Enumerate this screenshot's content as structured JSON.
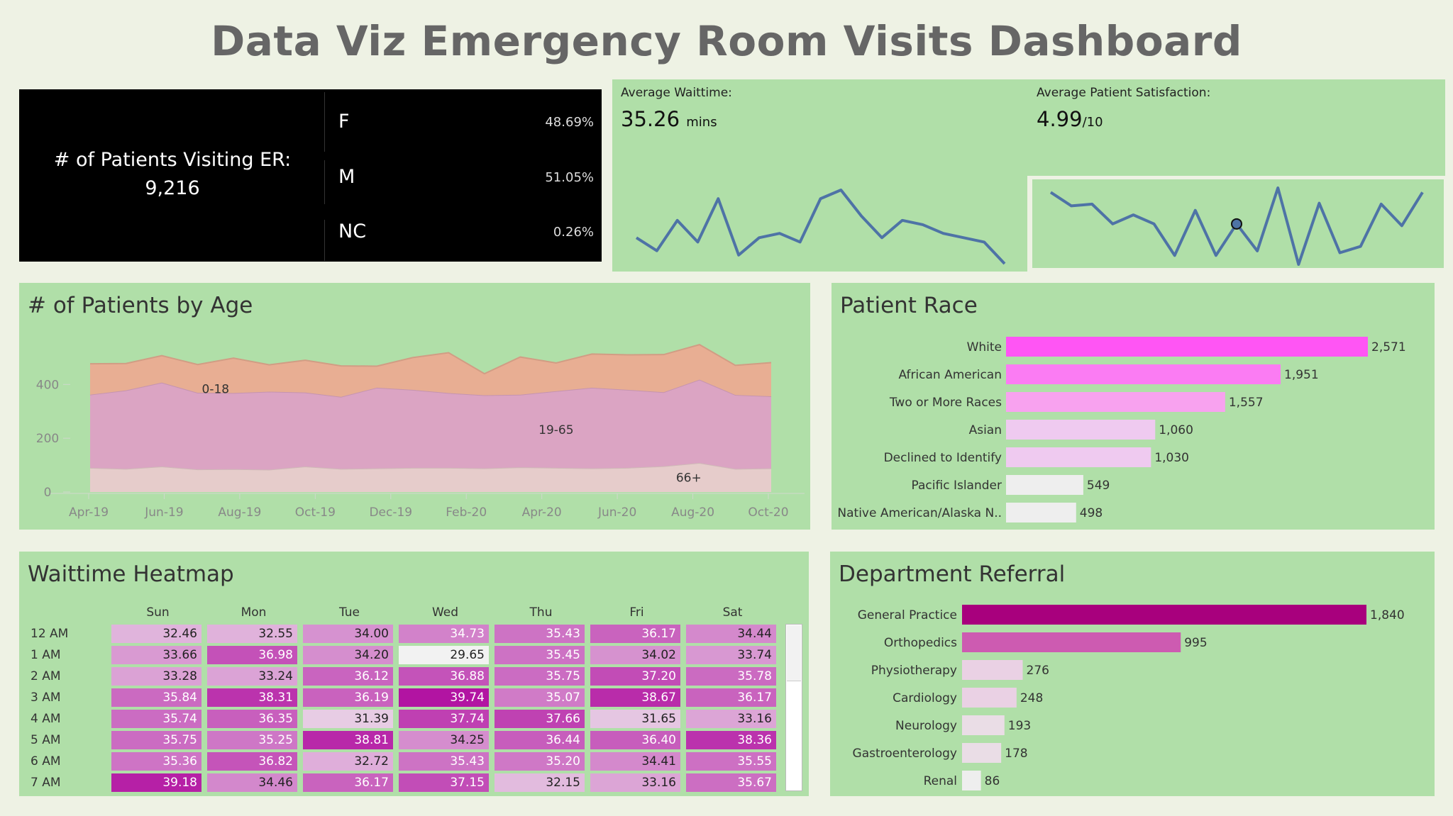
{
  "title": "Data Viz Emergency Room Visits Dashboard",
  "patients": {
    "label": "# of Patients Visiting ER:",
    "count": "9,216",
    "genders": [
      {
        "label": "F",
        "pct": "48.69%"
      },
      {
        "label": "M",
        "pct": "51.05%"
      },
      {
        "label": "NC",
        "pct": "0.26%"
      }
    ]
  },
  "waittime": {
    "label": "Average Waittime:",
    "value": "35.26",
    "unit": "mins"
  },
  "satisfaction": {
    "label": "Average Patient Satisfaction:",
    "value": "4.99",
    "unit": "/10"
  },
  "colors": {
    "panel": "#b0dfa8",
    "background": "#eef2e4",
    "line": "#4e73a6",
    "bar_top": "#ff55f4",
    "dept_top": "#a8007d"
  },
  "chart_data": [
    {
      "id": "waittime_trend",
      "type": "line",
      "values": [
        34.9,
        34.6,
        35.3,
        34.8,
        35.8,
        34.5,
        34.9,
        35.0,
        34.8,
        35.8,
        36.0,
        35.4,
        34.9,
        35.3,
        35.2,
        35.0,
        34.9,
        34.8,
        34.3
      ]
    },
    {
      "id": "satisfaction_trend",
      "type": "line",
      "values": [
        5.4,
        5.25,
        5.27,
        5.05,
        5.15,
        5.05,
        4.7,
        5.2,
        4.7,
        5.05,
        4.75,
        5.45,
        4.6,
        5.28,
        4.73,
        4.8,
        5.27,
        5.03,
        5.4
      ],
      "highlight_index": 9
    },
    {
      "id": "patients_by_age",
      "type": "area",
      "title": "# of Patients by Age",
      "x_ticks": [
        "Apr-19",
        "Jun-19",
        "Aug-19",
        "Oct-19",
        "Dec-19",
        "Feb-20",
        "Apr-20",
        "Jun-20",
        "Aug-20",
        "Oct-20"
      ],
      "y_ticks": [
        "0",
        "200",
        "400"
      ],
      "ylim": [
        0,
        580
      ],
      "series": [
        {
          "name": "66+",
          "color": "#e6cccb",
          "values": [
            90,
            86,
            95,
            84,
            85,
            83,
            95,
            86,
            88,
            90,
            90,
            88,
            92,
            90,
            88,
            90,
            96,
            108,
            86,
            88
          ]
        },
        {
          "name": "19-65",
          "color": "#dba4c3",
          "values": [
            272,
            292,
            312,
            285,
            283,
            290,
            275,
            268,
            300,
            290,
            278,
            272,
            270,
            285,
            300,
            290,
            275,
            310,
            275,
            268
          ]
        },
        {
          "name": "0-18",
          "color": "#e8ae93",
          "values": [
            115,
            100,
            100,
            105,
            130,
            100,
            120,
            115,
            80,
            120,
            150,
            80,
            140,
            105,
            125,
            130,
            140,
            130,
            110,
            125
          ]
        }
      ]
    },
    {
      "id": "patient_race",
      "type": "bar",
      "title": "Patient Race",
      "categories": [
        "White",
        "African American",
        "Two or More Races",
        "Asian",
        "Declined to Identify",
        "Pacific Islander",
        "Native American/Alaska N.."
      ],
      "values": [
        2571,
        1951,
        1557,
        1060,
        1030,
        549,
        498
      ],
      "labels": [
        "2,571",
        "1,951",
        "1,557",
        "1,060",
        "1,030",
        "549",
        "498"
      ],
      "colors": [
        "#ff55f4",
        "#fb7cf3",
        "#f8a2ef",
        "#efcaf0",
        "#efcaf0",
        "#eeeeee",
        "#eeeeee"
      ]
    },
    {
      "id": "department_referral",
      "type": "bar",
      "title": "Department Referral",
      "categories": [
        "General Practice",
        "Orthopedics",
        "Physiotherapy",
        "Cardiology",
        "Neurology",
        "Gastroenterology",
        "Renal"
      ],
      "values": [
        1840,
        995,
        276,
        248,
        193,
        178,
        86
      ],
      "labels": [
        "1,840",
        "995",
        "276",
        "248",
        "193",
        "178",
        "86"
      ],
      "colors": [
        "#a8007d",
        "#cd5bb1",
        "#ead1e4",
        "#ead1e4",
        "#eadde6",
        "#eadde6",
        "#eeeeee"
      ]
    },
    {
      "id": "waittime_heatmap",
      "type": "heatmap",
      "title": "Waittime Heatmap",
      "columns": [
        "Sun",
        "Mon",
        "Tue",
        "Wed",
        "Thu",
        "Fri",
        "Sat"
      ],
      "rows": [
        "12 AM",
        "1 AM",
        "2 AM",
        "3 AM",
        "4 AM",
        "5 AM",
        "6 AM",
        "7 AM"
      ],
      "values": [
        [
          "32.46",
          "32.55",
          "34.00",
          "34.73",
          "35.43",
          "36.17",
          "34.44"
        ],
        [
          "33.66",
          "36.98",
          "34.20",
          "29.65",
          "35.45",
          "34.02",
          "33.74"
        ],
        [
          "33.28",
          "33.24",
          "36.12",
          "36.88",
          "35.75",
          "37.20",
          "35.78"
        ],
        [
          "35.84",
          "38.31",
          "36.19",
          "39.74",
          "35.07",
          "38.67",
          "36.17"
        ],
        [
          "35.74",
          "36.35",
          "31.39",
          "37.74",
          "37.66",
          "31.65",
          "33.16"
        ],
        [
          "35.75",
          "35.25",
          "38.81",
          "34.25",
          "36.44",
          "36.40",
          "38.36"
        ],
        [
          "35.36",
          "36.82",
          "32.72",
          "35.43",
          "35.20",
          "34.41",
          "35.55"
        ],
        [
          "39.18",
          "34.46",
          "36.17",
          "37.15",
          "32.15",
          "33.16",
          "35.67"
        ]
      ]
    }
  ]
}
